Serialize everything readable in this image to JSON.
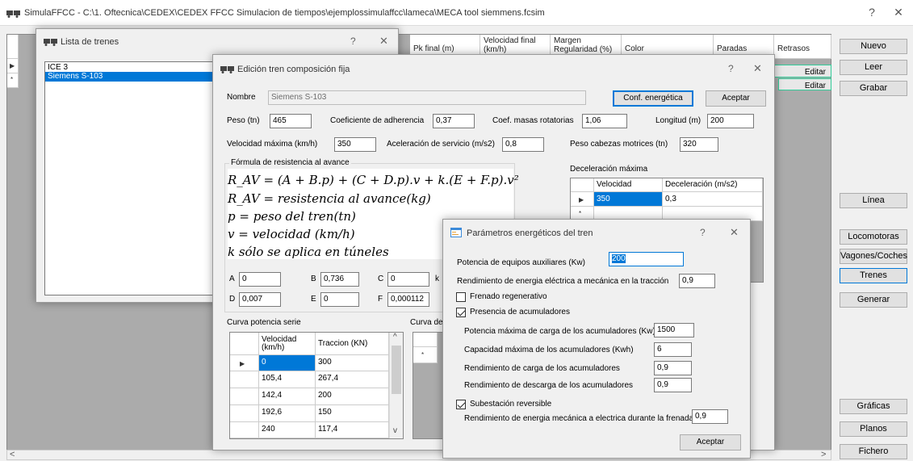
{
  "window": {
    "title": "SimulaFFCC - C:\\1. Oftecnica\\CEDEX\\CEDEX FFCC Simulacion de tiempos\\ejemplossimulaffcc\\lameca\\MECA tool siemmens.fcsim",
    "help": "?",
    "close": "✕"
  },
  "main_grid": {
    "columns": [
      "Pk final (m)",
      "Velocidad final",
      "Margen",
      "Color",
      "Paradas",
      "Retrasos"
    ],
    "columns_sub": [
      "",
      "(km/h)",
      "Regularidad (%)",
      "",
      "",
      ""
    ],
    "edit_labels": [
      "Editar",
      "Editar"
    ]
  },
  "sidebar": {
    "buttons": [
      "Nuevo",
      "Leer",
      "Grabar",
      "Línea",
      "Locomotoras",
      "Vagones/Coches",
      "Trenes",
      "Generar",
      "Gráficas",
      "Planos",
      "Fichero"
    ]
  },
  "train_list": {
    "title": "Lista de trenes",
    "help": "?",
    "close": "✕",
    "items": [
      "ICE 3",
      "Siemens S-103"
    ]
  },
  "edit_train": {
    "title": "Edición tren composición fija",
    "help": "?",
    "close": "✕",
    "nombre_label": "Nombre",
    "nombre_value": "Siemens S-103",
    "conf_button": "Conf. energética",
    "accept_button": "Aceptar",
    "peso_label": "Peso (tn)",
    "peso_value": "465",
    "adherencia_label": "Coeficiente de adherencia",
    "adherencia_value": "0,37",
    "masas_label": "Coef. masas rotatorias",
    "masas_value": "1,06",
    "longitud_label": "Longitud (m)",
    "longitud_value": "200",
    "vmax_label": "Velocidad máxima (km/h)",
    "vmax_value": "350",
    "acel_label": "Aceleración de servicio (m/s2)",
    "acel_value": "0,8",
    "cabezas_label": "Peso cabezas motrices (tn)",
    "cabezas_value": "320",
    "formula_group": "Fórmula de resistencia al avance",
    "formula_lines": [
      "R_AV = (A + B.p) + (C + D.p).v + k.(E + F.p).v²",
      "R_AV = resistencia al avance(kg)",
      "p = peso del tren(tn)",
      "v = velocidad (km/h)",
      "k   sólo se aplica en túneles"
    ],
    "coef": {
      "A_label": "A",
      "A": "0",
      "B_label": "B",
      "B": "0,736",
      "C_label": "C",
      "C": "0",
      "k_label": "k",
      "D_label": "D",
      "D": "0,007",
      "E_label": "E",
      "E": "0",
      "F_label": "F",
      "F": "0,000112"
    },
    "decel_title": "Deceleración máxima",
    "decel_headers": [
      "Velocidad",
      "Deceleración (m/s2)"
    ],
    "decel_rows": [
      [
        "350",
        "0,3"
      ]
    ],
    "curva_serie_title": "Curva potencia serie",
    "curva_serie_headers": [
      "Velocidad (km/h)",
      "Traccion (KN)"
    ],
    "curva_serie_rows": [
      [
        "0",
        "300"
      ],
      [
        "105,4",
        "267,4"
      ],
      [
        "142,4",
        "200"
      ],
      [
        "192,6",
        "150"
      ],
      [
        "240",
        "117,4"
      ]
    ],
    "curva_p_title": "Curva de p"
  },
  "energy": {
    "title": "Parámetros energéticos del tren",
    "help": "?",
    "close": "✕",
    "aux_label": "Potencia de equipos auxiliares (Kw)",
    "aux_value": "200",
    "rend_traccion_label": "Rendimiento de energia eléctrica a mecánica en la tracción",
    "rend_traccion_value": "0,9",
    "frenado_label": "Frenado regenerativo",
    "frenado_checked": false,
    "acum_label": "Presencia de acumuladores",
    "acum_checked": true,
    "pot_carga_label": "Potencia máxima de carga de los acumuladores (Kw)",
    "pot_carga_value": "1500",
    "capacidad_label": "Capacidad máxima de los acumuladores (Kwh)",
    "capacidad_value": "6",
    "rend_carga_label": "Rendimiento de carga de los acumuladores",
    "rend_carga_value": "0,9",
    "rend_descarga_label": "Rendimiento de descarga de los acumuladores",
    "rend_descarga_value": "0,9",
    "subestacion_label": "Subestación reversible",
    "subestacion_checked": true,
    "rend_frenada_label": "Rendimiento de energia mecánica a electrica durante la frenada",
    "rend_frenada_value": "0,9",
    "accept_button": "Aceptar"
  },
  "colors": {
    "selection": "#0078d7",
    "grid_bg": "#ababab"
  }
}
